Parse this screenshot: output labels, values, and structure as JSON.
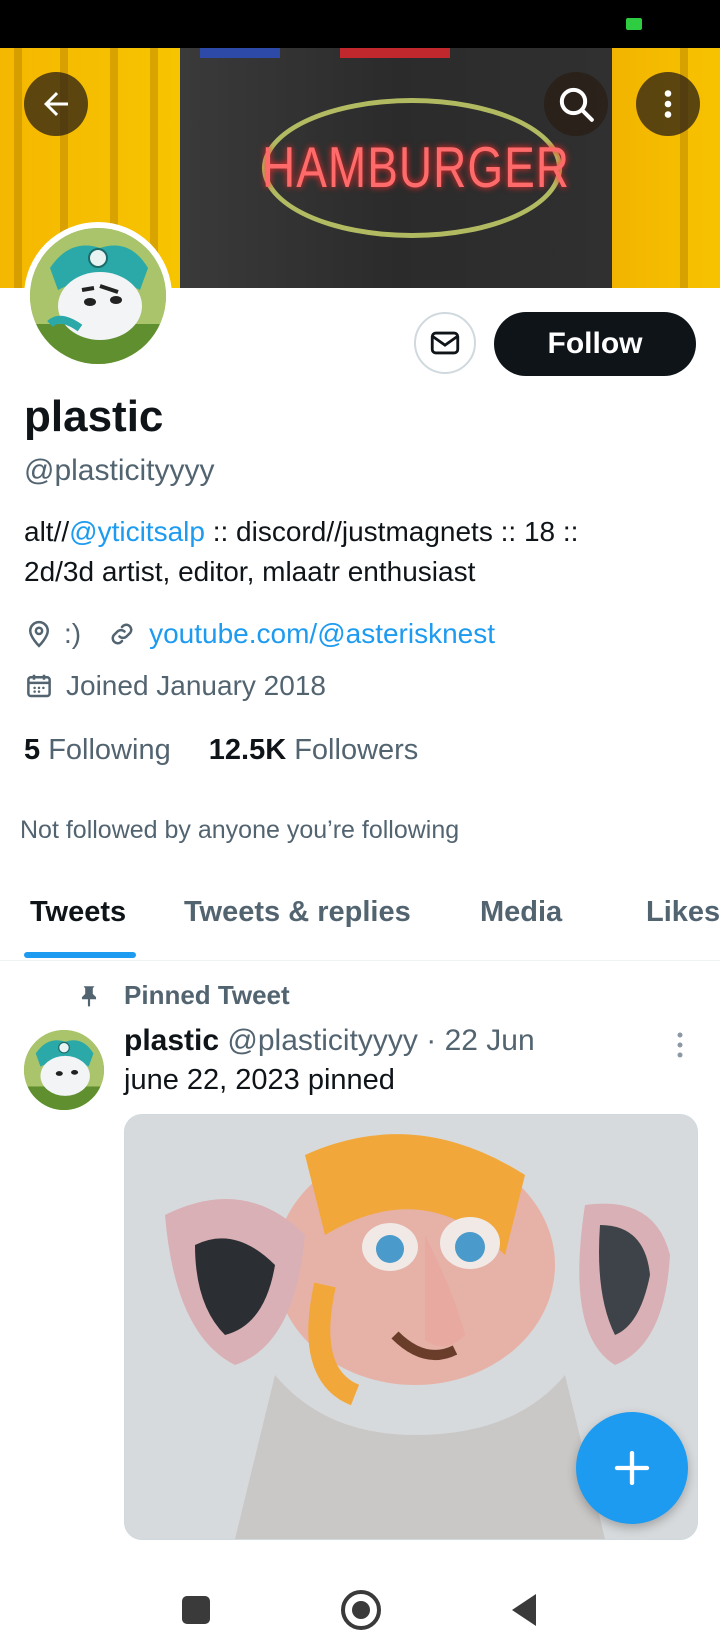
{
  "header": {
    "banner_sign_text": "HAMBURGER",
    "back_label": "back",
    "search_label": "search",
    "more_label": "more"
  },
  "profile": {
    "display_name": "plastic",
    "handle": "@plasticityyyy",
    "bio_prefix": "alt//",
    "bio_mention": "@yticitsalp",
    "bio_rest_line1": " :: discord//justmagnets :: 18 ::",
    "bio_line2": "2d/3d artist, editor, mlaatr enthusiast",
    "location": ":)",
    "website": "youtube.com/@asterisknest",
    "joined": "Joined January 2018",
    "following_count": "5",
    "following_label": "Following",
    "followers_count": "12.5K",
    "followers_label": "Followers",
    "not_followed_text": "Not followed by anyone you’re following",
    "follow_button": "Follow"
  },
  "tabs": [
    {
      "label": "Tweets",
      "active": true
    },
    {
      "label": "Tweets & replies",
      "active": false
    },
    {
      "label": "Media",
      "active": false
    },
    {
      "label": "Likes",
      "active": false
    }
  ],
  "tweet": {
    "pinned_label": "Pinned Tweet",
    "author_name": "plastic",
    "author_handle": "@plasticityyyy",
    "separator": "·",
    "date": "22 Jun",
    "text": "june 22, 2023 pinned"
  },
  "colors": {
    "accent": "#1d9bf0",
    "text_primary": "#0f1419",
    "text_secondary": "#536471"
  }
}
